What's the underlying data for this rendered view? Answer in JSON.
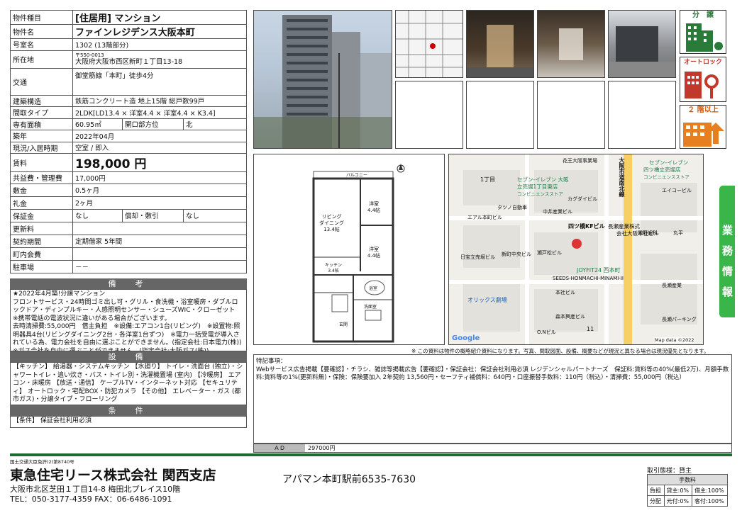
{
  "spec": {
    "rows": [
      {
        "label": "物件種目",
        "value": "[住居用] マンション",
        "style": "big"
      },
      {
        "label": "物件名",
        "value": "ファインレジデンス大阪本町",
        "style": "big"
      },
      {
        "label": "号室名",
        "value": "1302 (13階部分)"
      },
      {
        "label": "所在地",
        "postal": "〒550-0013",
        "value": "大阪府大阪市西区新町１丁目13-18"
      },
      {
        "label": "交通",
        "value": "御堂筋線「本町」徒歩4分"
      },
      {
        "label": "建築構造",
        "value": "鉄筋コンクリート造 地上15階 総戸数99戸"
      },
      {
        "label": "間取タイプ",
        "value": "2LDK[LD13.4 × 洋室4.4 × 洋室4.4 × K3.4]"
      },
      {
        "label": "専有面積",
        "value": "60.95㎡",
        "label2": "開口部方位",
        "value2": "北"
      },
      {
        "label": "築年",
        "value": "2022年04月"
      },
      {
        "label": "現況/入居時期",
        "value": "空室 / 即入"
      },
      {
        "label": "賃料",
        "value": "198,000 円",
        "style": "rent"
      },
      {
        "label": "共益費・管理費",
        "value": "17,000円"
      },
      {
        "label": "敷金",
        "value": "0.5ヶ月"
      },
      {
        "label": "礼金",
        "value": "2ヶ月"
      },
      {
        "label": "保証金",
        "value": "なし",
        "label2": "償却・敷引",
        "value2": "なし"
      },
      {
        "label": "更新料",
        "value": ""
      },
      {
        "label": "契約期間",
        "value": "定期借家 5年間"
      },
      {
        "label": "町内会費",
        "value": ""
      },
      {
        "label": "駐車場",
        "value": "－－"
      }
    ]
  },
  "remarks": {
    "title": "備　考",
    "text": "★2022年4月築!分譲マンション\nフロントサービス・24時間ゴミ出し可・グリル・食洗機・浴室暖房・ダブルロックドア・ディンプルキー・人感照明センサー・シューズWIC・クローゼット\n※携帯電話の電波状況に違いがある場合がございます。\n去時清掃費:55,000円　借主負担　※設備:エアコン1台(リビング)　※設置物:照明器具4台(リビングダイニング2台・各洋室1台ずつ)　※電力一括受電が導入されている為、電力会社を自由に選ぶことができません。(指定会社:日本電力(株))\n※ガス会社を自由に選ぶことができません。(指定会社:大阪ガス(株))"
  },
  "equipment": {
    "title": "設　備",
    "text": "【キッチン】 給湯器・システムキッチン 【水廻り】 トイレ・洗面台 (独立)・シャワートイレ・追い炊き・バス・トイレ別・洗濯機置場 (室内) 【冷暖房】 エアコン・床暖房 【放送・通信】 ケーブルTV・インターネット対応 【セキュリティ】 オートロック・宅配BOX・防犯カメラ 【その他】 エレベーター・ガス (都市ガス)・分譲タイプ・フローリング"
  },
  "conditions": {
    "title": "条　件",
    "text": "【条件】 保証会社利用必須"
  },
  "badges": {
    "b1": "分　譲",
    "b2": "オートロック",
    "b3": "２ 階以上"
  },
  "side_tab": "業務情報",
  "floorplan": {
    "balcony": "バルコニー",
    "living": "リビング\nダイニング\n13.4帖",
    "room1": "洋室\n4.4帖",
    "room2": "洋室\n4.4帖",
    "kitchen": "キッチン\n3.4帖",
    "bath": "浴室",
    "wash": "洗面室",
    "entrance": "玄関"
  },
  "map": {
    "labels": [
      "花王大阪事業場",
      "セブン-イレブン 大阪",
      "立売堀1丁目東店",
      "コンビニエンスストア",
      "カグダイビル",
      "セブン-イレブン",
      "四ツ橋立売堀店",
      "コンビニエンスストア",
      "エイコービル",
      "1丁目",
      "タツノ自動車",
      "エアル本町ビル",
      "中井産業ビル",
      "四ツ橋KFビル",
      "長瀬産業株式",
      "会社大阪本社ビル",
      "関野歯科",
      "丸平",
      "日宝立売堀ビル",
      "新町中央ビル",
      "瀬戸松ビル",
      "JOYFIT24 西本町",
      "SEEDS-HONMACHI-MINAMI-II",
      "オリックス劇場",
      "本社ビル",
      "長瀬産業",
      "森本興産ビル",
      "長瀬パーキング",
      "O.Nビル",
      "11",
      "大阪市道南北線",
      "Google",
      "Map data ©2022"
    ]
  },
  "map_note": "※ この資料は物件の概略紹介資料になります。写真、間取図面、設備、概要などが現況と異なる場合は現況優先となります。",
  "special": {
    "title": "特記事項：",
    "text": "Webサービス広告掲載【要確認】・チラシ、雑誌等掲載広告【要確認】・保証会社：保証会社利用必須 レジデンシャルパートナーズ　保証料:賃料等の40%(最低2万)、月額手数料:賃料等の1%(更新料無)・保険：保険要加入 2年契約 13,560円・セーフティ補償料：640円・口座振替手数料：110円（税込）・清掃費：55,000円（税込）"
  },
  "ad": {
    "label": "ＡＤ",
    "value": "297000円"
  },
  "company": {
    "license": "国土交通大臣免許(2)第8740号",
    "name": "東急住宅リース株式会社 関西支店",
    "address": "大阪市北区芝田１丁目14-8 梅田北プレイス10階",
    "tel": "TEL：050-3177-4359 FAX：06-6486-1091"
  },
  "store": "アパマン本町駅前6535-7630",
  "fees": {
    "mode": "取引態様：貸主",
    "header": "手数料",
    "rows": [
      {
        "label": "負担",
        "v1": "貸主:0%",
        "v2": "借主:100%"
      },
      {
        "label": "分配",
        "v1": "元付:0%",
        "v2": "客付:100%"
      }
    ]
  }
}
